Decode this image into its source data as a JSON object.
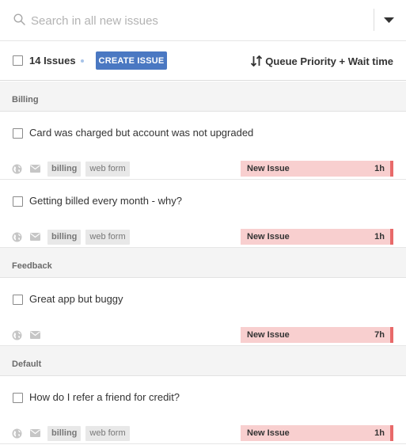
{
  "search": {
    "placeholder": "Search in all new issues",
    "icon": "search-icon"
  },
  "toolbar": {
    "issue_count": "14 Issues",
    "create_button": "CREATE ISSUE",
    "sort_label": "Queue Priority + Wait time",
    "accent_color": "#4a78c2"
  },
  "groups": [
    {
      "label": "Billing",
      "issues": [
        {
          "title": "Card was charged but account was not upgraded",
          "tags": [
            "billing",
            "web form"
          ],
          "status": "New Issue",
          "time": "1h"
        },
        {
          "title": "Getting billed every month - why?",
          "tags": [
            "billing",
            "web form"
          ],
          "status": "New Issue",
          "time": "1h"
        }
      ]
    },
    {
      "label": "Feedback",
      "issues": [
        {
          "title": "Great app but buggy",
          "tags": [],
          "status": "New Issue",
          "time": "7h"
        }
      ]
    },
    {
      "label": "Default",
      "issues": [
        {
          "title": "How do I refer a friend for credit?",
          "tags": [
            "billing",
            "web form"
          ],
          "status": "New Issue",
          "time": "1h"
        }
      ]
    }
  ],
  "status_colors": {
    "background": "#f8cfcf",
    "bar": "#e86a6a"
  }
}
